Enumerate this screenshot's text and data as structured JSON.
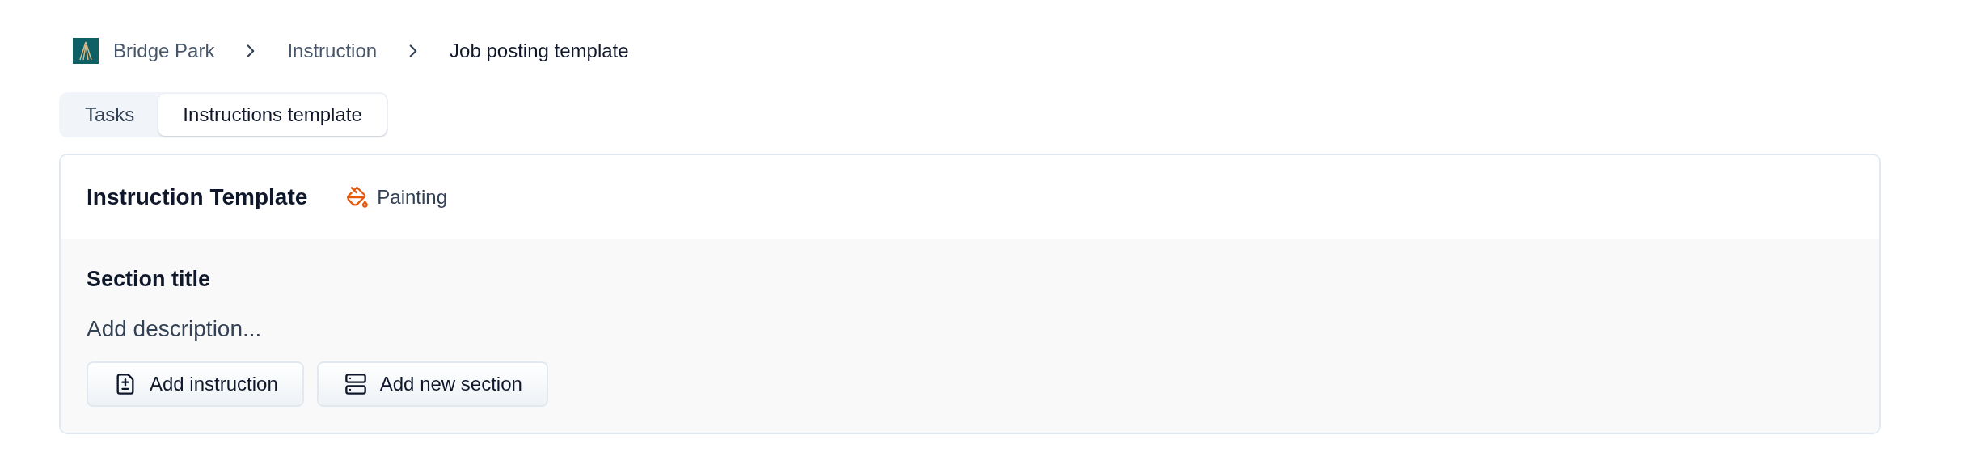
{
  "breadcrumb": [
    {
      "label": "Bridge Park",
      "kind": "logo"
    },
    {
      "label": "Instruction",
      "kind": "link"
    },
    {
      "label": "Job posting template",
      "kind": "current"
    }
  ],
  "tabs": [
    {
      "label": "Tasks",
      "selected": false
    },
    {
      "label": "Instructions template",
      "selected": true
    }
  ],
  "card": {
    "title": "Instruction Template",
    "category": "Painting",
    "section": {
      "title": "Section title",
      "description": {
        "placeholder": "Add description..."
      },
      "buttons": [
        {
          "label": "Add instruction",
          "kind": "instruction"
        },
        {
          "label": "Add new section",
          "kind": "section"
        }
      ]
    }
  }
}
